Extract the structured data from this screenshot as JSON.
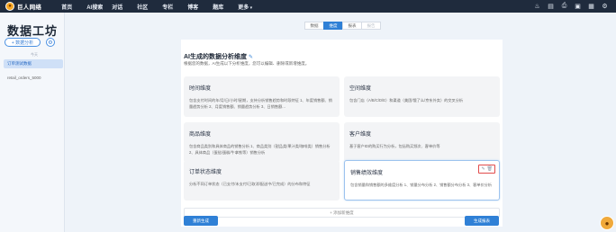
{
  "app": {
    "brand": "巨人网络",
    "brand_icon": "lion-logo-icon"
  },
  "topnav": {
    "items": [
      {
        "label": "首页",
        "dropdown": false
      },
      {
        "label": "AI搜索",
        "dropdown": false
      },
      {
        "label": "对话",
        "dropdown": false
      },
      {
        "label": "社区",
        "dropdown": false
      },
      {
        "label": "专栏",
        "dropdown": false
      },
      {
        "label": "博客",
        "dropdown": false
      },
      {
        "label": "题库",
        "dropdown": false
      },
      {
        "label": "更多",
        "dropdown": true
      }
    ],
    "right_icons": [
      "bell-icon",
      "document-icon",
      "printer-icon",
      "wallet-icon",
      "grid-icon",
      "settings-icon"
    ]
  },
  "sidebar": {
    "title": "数据工坊",
    "add_button": "+ 数据分析",
    "section_label": "今天",
    "active_item": "订单测试数据",
    "items": [
      "retail_orders_5000"
    ]
  },
  "tabs": [
    {
      "label": "数据",
      "state": "normal"
    },
    {
      "label": "维度",
      "state": "active"
    },
    {
      "label": "报表",
      "state": "normal"
    },
    {
      "label": "报告",
      "state": "muted"
    }
  ],
  "main": {
    "heading": "AI生成的数据分析维度",
    "subline": "根据您的数据，AI生成以下分析维度，您可以编辑、删除或新增维度。",
    "cards": [
      {
        "title": "时间维度",
        "desc": "包含支付时间的年/月/日/小时/星期，支持分析销售趋势和时段特征 1、年度销售额、销量趋势分析 2、月度销售额、销量趋势分析 3、日销售额..."
      },
      {
        "title": "空间维度",
        "desc": "包含门店（A/B/C/D/E）和渠道（美团/饿了么/京东外卖）的交叉分析"
      },
      {
        "title": "商品维度",
        "desc": "包含商品类别和具体商品的销售分析 1、商品类别（甜品类/果汁类/咖啡类）销售分析 2、具体商品（蛋挞/蛋糕/牛拿铁等）销售分析"
      },
      {
        "title": "客户维度",
        "desc": "基于客户ID的购买行为分析，包括购买频次、客单价等"
      },
      {
        "title": "订单状态维度",
        "desc": "分析不同订单状态（已支付/未支付/已取消/配送中/已完成）的分布和特征"
      },
      {
        "title": "销售绩效维度",
        "desc": "包含销量和销售额的多维度分析 1、销量分布分析 2、销售额分布分析 3、客单价分析"
      }
    ],
    "add_dimension": "+ 添加新维度",
    "regen_button": "重新生成",
    "report_button": "生成报表"
  }
}
